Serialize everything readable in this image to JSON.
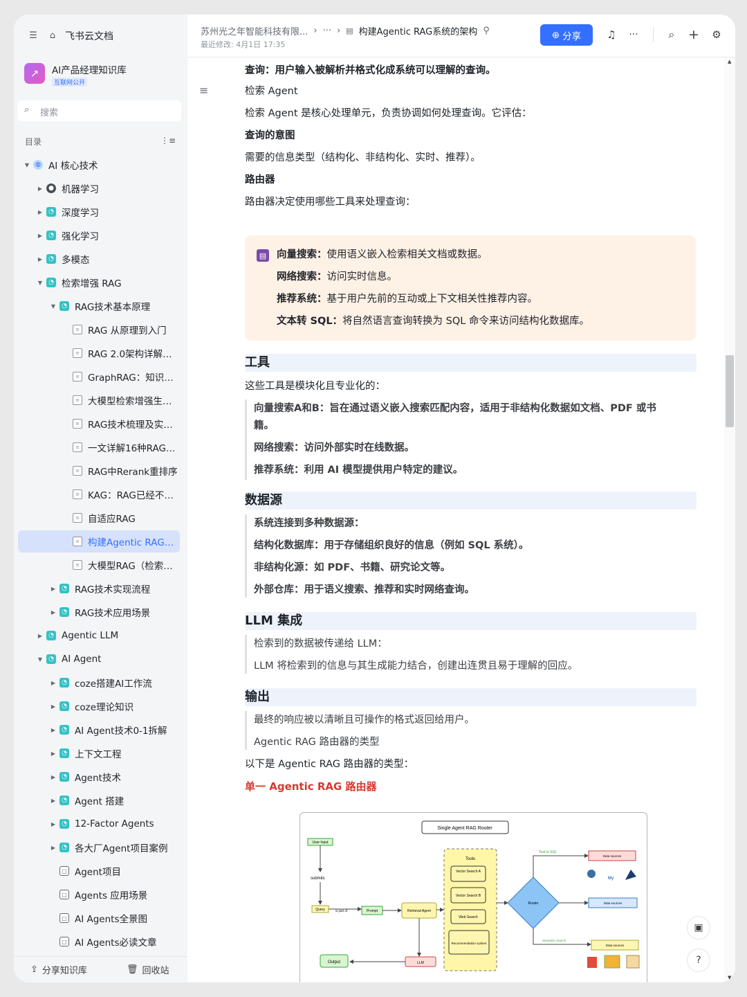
{
  "sidebar": {
    "brand": "飞书云文档",
    "kb_title": "AI产品经理知识库",
    "kb_badge": "互联网公开",
    "search_placeholder": "搜索",
    "toc_label": "目录",
    "items": [
      {
        "label": "AI 核心技术",
        "icon": "globe",
        "arrow": "▼",
        "level": 0
      },
      {
        "label": "机器学习",
        "icon": "bot",
        "arrow": "▶",
        "level": 1
      },
      {
        "label": "深度学习",
        "icon": "wiki",
        "arrow": "▶",
        "level": 1
      },
      {
        "label": "强化学习",
        "icon": "wiki",
        "arrow": "▶",
        "level": 1
      },
      {
        "label": "多模态",
        "icon": "wiki",
        "arrow": "▶",
        "level": 1
      },
      {
        "label": "检索增强 RAG",
        "icon": "wiki",
        "arrow": "▼",
        "level": 1
      },
      {
        "label": "RAG技术基本原理",
        "icon": "wiki",
        "arrow": "▼",
        "level": 2
      },
      {
        "label": "RAG 从原理到入门",
        "icon": "doc",
        "arrow": "",
        "level": 3
      },
      {
        "label": "RAG 2.0架构详解：...",
        "icon": "doc",
        "arrow": "",
        "level": 3
      },
      {
        "label": "GraphRAG：知识图...",
        "icon": "doc",
        "arrow": "",
        "level": 3
      },
      {
        "label": "大模型检索增强生成...",
        "icon": "doc",
        "arrow": "",
        "level": 3
      },
      {
        "label": "RAG技术梳理及实践...",
        "icon": "doc",
        "arrow": "",
        "level": 3
      },
      {
        "label": "一文详解16种RAG架...",
        "icon": "doc",
        "arrow": "",
        "level": 3
      },
      {
        "label": "RAG中Rerank重排序",
        "icon": "doc",
        "arrow": "",
        "level": 3
      },
      {
        "label": "KAG：RAG已经不够...",
        "icon": "doc",
        "arrow": "",
        "level": 3
      },
      {
        "label": "自适应RAG",
        "icon": "doc",
        "arrow": "",
        "level": 3
      },
      {
        "label": "构建Agentic RAG系...",
        "icon": "doc",
        "arrow": "",
        "level": 3,
        "active": true
      },
      {
        "label": "大模型RAG（检索增...",
        "icon": "doc",
        "arrow": "",
        "level": 3
      },
      {
        "label": "RAG技术实现流程",
        "icon": "wiki",
        "arrow": "▶",
        "level": 2
      },
      {
        "label": "RAG技术应用场景",
        "icon": "wiki",
        "arrow": "▶",
        "level": 2
      },
      {
        "label": "Agentic LLM",
        "icon": "wiki",
        "arrow": "▶",
        "level": 1
      },
      {
        "label": "AI Agent",
        "icon": "wiki",
        "arrow": "▼",
        "level": 1
      },
      {
        "label": "coze搭建AI工作流",
        "icon": "wiki",
        "arrow": "▶",
        "level": 2
      },
      {
        "label": "coze理论知识",
        "icon": "wiki",
        "arrow": "▶",
        "level": 2
      },
      {
        "label": "AI Agent技术0-1拆解",
        "icon": "wiki",
        "arrow": "▶",
        "level": 2
      },
      {
        "label": "上下文工程",
        "icon": "wiki",
        "arrow": "▶",
        "level": 2
      },
      {
        "label": "Agent技术",
        "icon": "wiki",
        "arrow": "▶",
        "level": 2
      },
      {
        "label": "Agent 搭建",
        "icon": "wiki",
        "arrow": "▶",
        "level": 2
      },
      {
        "label": "12-Factor Agents",
        "icon": "wiki",
        "arrow": "▶",
        "level": 2
      },
      {
        "label": "各大厂Agent项目案例",
        "icon": "wiki",
        "arrow": "▶",
        "level": 2
      },
      {
        "label": "Agent项目",
        "icon": "folder",
        "arrow": "",
        "level": 2
      },
      {
        "label": "Agents 应用场景",
        "icon": "folder",
        "arrow": "",
        "level": 2
      },
      {
        "label": "AI Agents全景图",
        "icon": "folder",
        "arrow": "",
        "level": 2
      },
      {
        "label": "AI Agents必读文章",
        "icon": "folder",
        "arrow": "",
        "level": 2
      }
    ],
    "footer_share": "分享知识库",
    "footer_trash": "回收站"
  },
  "header": {
    "breadcrumb_company": "苏州光之年智能科技有限...",
    "breadcrumb_more": "···",
    "breadcrumb_doc": "构建Agentic RAG系统的架构",
    "last_modified": "最近修改: 4月1日 17:35",
    "share_label": "分享",
    "more": "···"
  },
  "content": {
    "p1": "查询：用户输入被解析并格式化成系统可以理解的查询。",
    "p2": "检索 Agent",
    "p3": "检索 Agent 是核心处理单元，负责协调如何处理查询。它评估：",
    "p4": "查询的意图",
    "p5": "需要的信息类型（结构化、非结构化、实时、推荐）。",
    "p6": "路由器",
    "p7": "路由器决定使用哪些工具来处理查询：",
    "callout": [
      {
        "k": "向量搜索：",
        "v": "使用语义嵌入检索相关文档或数据。"
      },
      {
        "k": "网络搜索：",
        "v": "访问实时信息。"
      },
      {
        "k": "推荐系统：",
        "v": "基于用户先前的互动或上下文相关性推荐内容。"
      },
      {
        "k": "文本转 SQL：",
        "v": "将自然语言查询转换为 SQL 命令来访问结构化数据库。"
      }
    ],
    "h_tools": "工具",
    "tools_intro": "这些工具是模块化且专业化的：",
    "tools_q1": "向量搜索A和B：旨在通过语义嵌入搜索匹配内容，适用于非结构化数据如文档、PDF 或书",
    "tools_q1b": "籍。",
    "tools_q2": "网络搜索：访问外部实时在线数据。",
    "tools_q3": "推荐系统：利用 AI 模型提供用户特定的建议。",
    "h_data": "数据源",
    "data_q1": "系统连接到多种数据源：",
    "data_q2": "结构化数据库：用于存储组织良好的信息（例如 SQL 系统）。",
    "data_q3": "非结构化源：如 PDF、书籍、研究论文等。",
    "data_q4": "外部仓库：用于语义搜索、推荐和实时网络查询。",
    "h_llm": "LLM 集成",
    "llm_q1": "检索到的数据被传递给 LLM：",
    "llm_q2": "LLM 将检索到的信息与其生成能力结合，创建出连贯且易于理解的回应。",
    "h_out": "输出",
    "out_q1": "最终的响应被以清晰且可操作的格式返回给用户。",
    "out_q2": "Agentic RAG 路由器的类型",
    "p_types": "以下是 Agentic RAG 路由器的类型：",
    "h_single": "单一 Agentic RAG 路由器"
  },
  "diagram": {
    "title": "Single Agent RAG Router",
    "user_input": "User Input",
    "submits": "submits",
    "query": "Query",
    "is_part_of": "is part of",
    "prompt": "Prompt",
    "retrieval_agent": "Retrieval Agent",
    "tools": "Tools",
    "vec_a": "Vector Search A",
    "vec_b": "Vector Search B",
    "web": "Web Search",
    "rec": "Recommendation system",
    "router": "Router",
    "text_to_sql": "Text to SQL",
    "semantic": "Semantic Search",
    "ds": "Data sources",
    "llm": "LLM",
    "output": "Output"
  }
}
